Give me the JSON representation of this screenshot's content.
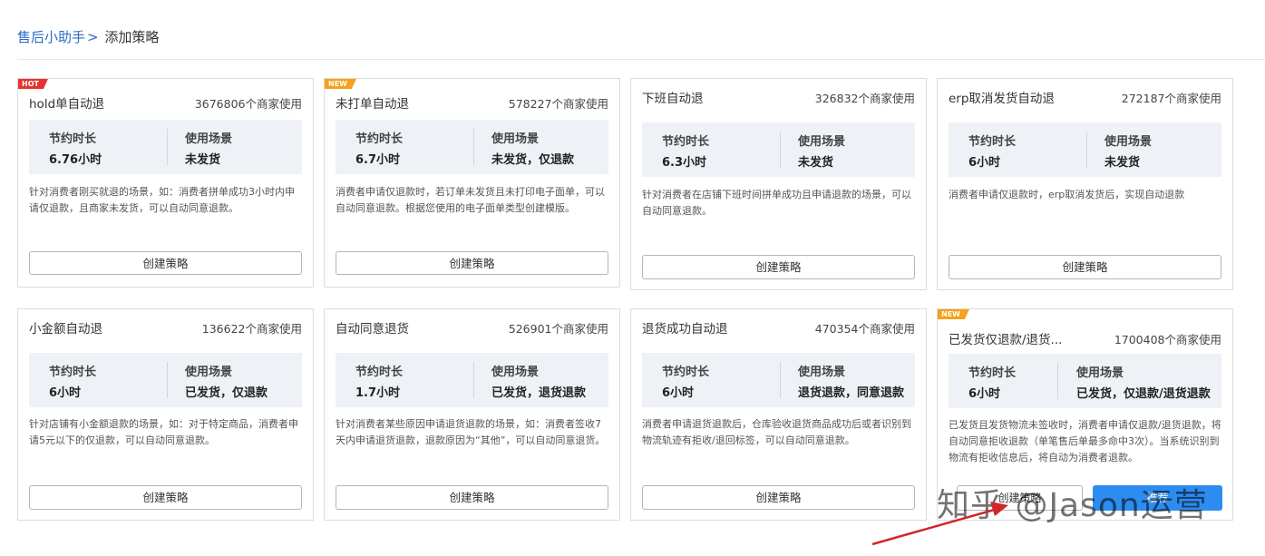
{
  "breadcrumb": {
    "parent": "售后小助手",
    "sep": ">",
    "current": "添加策略"
  },
  "labels": {
    "save_time": "节约时长",
    "scene": "使用场景"
  },
  "cards": [
    {
      "badge": "HOT",
      "title": "hold单自动退",
      "usage": "3676806个商家使用",
      "time": "6.76小时",
      "scene": "未发货",
      "desc": "针对消费者刚买就退的场景，如：消费者拼单成功3小时内申请仅退款，且商家未发货，可以自动同意退款。",
      "button": "创建策略"
    },
    {
      "badge": "NEW",
      "title": "未打单自动退",
      "usage": "578227个商家使用",
      "time": "6.7小时",
      "scene": "未发货，仅退款",
      "desc": "消费者申请仅退款时，若订单未发货且未打印电子面单，可以自动同意退款。根据您使用的电子面单类型创建模版。",
      "button": "创建策略"
    },
    {
      "badge": "",
      "title": "下班自动退",
      "usage": "326832个商家使用",
      "time": "6.3小时",
      "scene": "未发货",
      "desc": "针对消费者在店铺下班时间拼单成功且申请退款的场景，可以自动同意退款。",
      "button": "创建策略"
    },
    {
      "badge": "",
      "title": "erp取消发货自动退",
      "usage": "272187个商家使用",
      "time": "6小时",
      "scene": "未发货",
      "desc": "消费者申请仅退款时，erp取消发货后，实现自动退款",
      "button": "创建策略"
    },
    {
      "badge": "",
      "title": "小金额自动退",
      "usage": "136622个商家使用",
      "time": "6小时",
      "scene": "已发货，仅退款",
      "desc": "针对店铺有小金额退款的场景，如：对于特定商品，消费者申请5元以下的仅退款，可以自动同意退款。",
      "button": "创建策略"
    },
    {
      "badge": "",
      "title": "自动同意退货",
      "usage": "526901个商家使用",
      "time": "1.7小时",
      "scene": "已发货，退货退款",
      "desc": "针对消费者某些原因申请退货退款的场景，如：消费者签收7天内申请退货退款，退款原因为“其他”，可以自动同意退货。",
      "button": "创建策略"
    },
    {
      "badge": "",
      "title": "退货成功自动退",
      "usage": "470354个商家使用",
      "time": "6小时",
      "scene": "退货退款，同意退款",
      "desc": "消费者申请退货退款后，仓库验收退货商品成功后或者识别到物流轨迹有拒收/退回标签，可以自动同意退款。",
      "button": "创建策略"
    },
    {
      "badge": "NEW",
      "title": "已发货仅退款/退货...",
      "usage": "1700408个商家使用",
      "time": "6小时",
      "scene": "已发货，仅退款/退货退款",
      "desc": "已发货且发货物流未签收时，消费者申请仅退款/退货退款，将自动同意拒收退款（单笔售后单最多命中3次）。当系统识别到物流有拒收信息后，将自动为消费者退款。",
      "button": "创建策略",
      "button2": "推荐"
    }
  ],
  "watermark": "知乎 @Jason运营",
  "colors": {
    "accent": "#2d8cf0",
    "hot": "#e8322e",
    "new": "#f4a11b",
    "arrow": "#d0282a"
  }
}
